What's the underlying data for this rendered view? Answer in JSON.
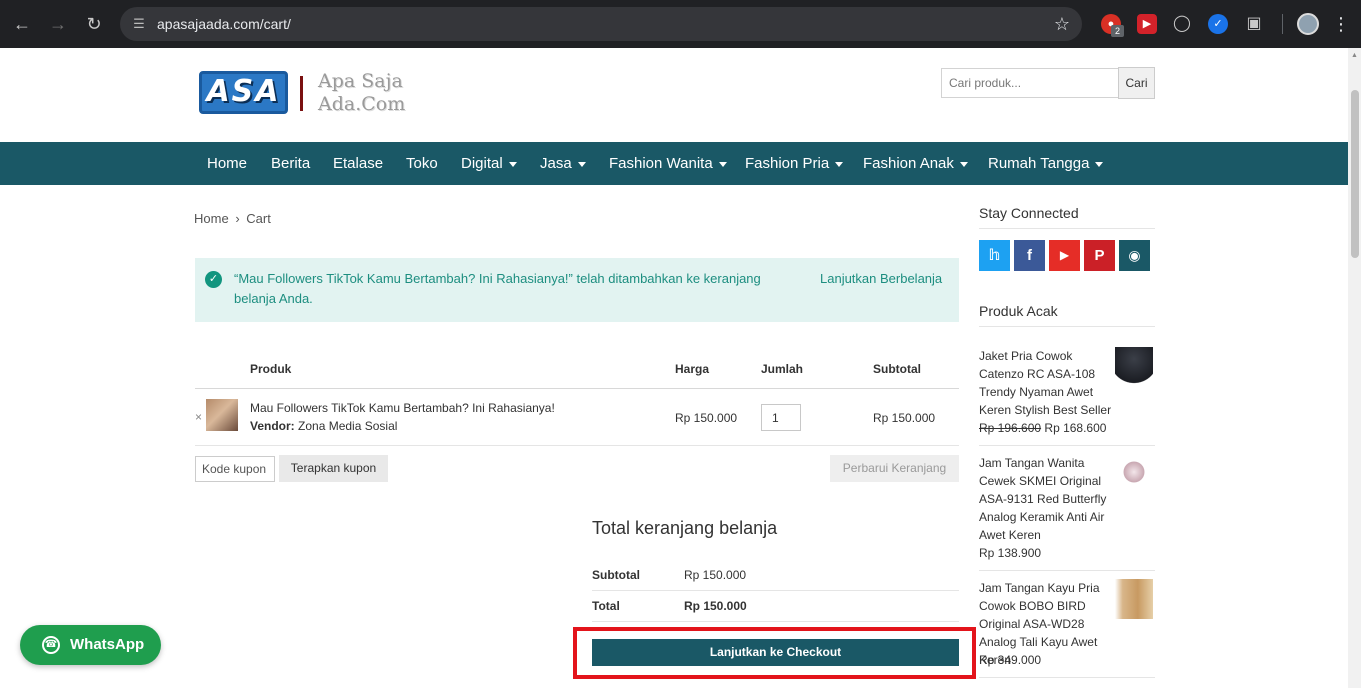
{
  "browser": {
    "url": "apasajaada.com/cart/",
    "ext_badge": "2"
  },
  "header": {
    "logo_mark": "ASA",
    "logo_line1": "Apa Saja",
    "logo_line2": "Ada.Com",
    "search_placeholder": "Cari produk...",
    "search_button": "Cari"
  },
  "nav": [
    {
      "label": "Home"
    },
    {
      "label": "Berita"
    },
    {
      "label": "Etalase"
    },
    {
      "label": "Toko"
    },
    {
      "label": "Digital"
    },
    {
      "label": "Jasa"
    },
    {
      "label": "Fashion Wanita"
    },
    {
      "label": "Fashion Pria"
    },
    {
      "label": "Fashion Anak"
    },
    {
      "label": "Rumah Tangga"
    }
  ],
  "breadcrumb": {
    "home": "Home",
    "sep": "›",
    "current": "Cart"
  },
  "notice": {
    "message": "“Mau Followers TikTok Kamu Bertambah? Ini Rahasianya!” telah ditambahkan ke keranjang belanja Anda.",
    "continue": "Lanjutkan Berbelanja"
  },
  "cart": {
    "headers": {
      "product": "Produk",
      "price": "Harga",
      "qty": "Jumlah",
      "subtotal": "Subtotal"
    },
    "item": {
      "remove": "×",
      "name": "Mau Followers TikTok Kamu Bertambah? Ini Rahasianya!",
      "vendor_label": "Vendor:",
      "vendor": "Zona Media Sosial",
      "price": "Rp 150.000",
      "qty": "1",
      "subtotal": "Rp 150.000"
    },
    "coupon_placeholder": "Kode kupon",
    "apply_coupon": "Terapkan kupon",
    "update_cart": "Perbarui Keranjang"
  },
  "totals": {
    "title": "Total keranjang belanja",
    "subtotal_label": "Subtotal",
    "subtotal_value": "Rp 150.000",
    "total_label": "Total",
    "total_value": "Rp 150.000",
    "checkout": "Lanjutkan ke Checkout"
  },
  "whatsapp": {
    "label": "WhatsApp"
  },
  "sidebar": {
    "stay_connected": "Stay Connected",
    "social": [
      "twitter-icon",
      "facebook-icon",
      "youtube-icon",
      "pinterest-icon",
      "instagram-icon"
    ],
    "colors": {
      "twitter": "#1da1f2",
      "facebook": "#3b5998",
      "youtube": "#e52d27",
      "pinterest": "#cb2027",
      "instagram": "#1a5866"
    },
    "random_products_title": "Produk Acak",
    "products": [
      {
        "name": "Jaket Pria Cowok Catenzo RC ASA-108 Trendy Nyaman Awet Keren Stylish Best Seller",
        "old_price": "Rp 196.600",
        "price": "Rp 168.600"
      },
      {
        "name": "Jam Tangan Wanita Cewek SKMEI Original ASA-9131 Red Butterfly Analog Keramik Anti Air Awet Keren",
        "price": "Rp 138.900"
      },
      {
        "name": "Jam Tangan Kayu Pria Cowok BOBO BIRD Original ASA-WD28 Analog Tali Kayu Awet Keren",
        "price": "Rp 349.000"
      }
    ]
  }
}
